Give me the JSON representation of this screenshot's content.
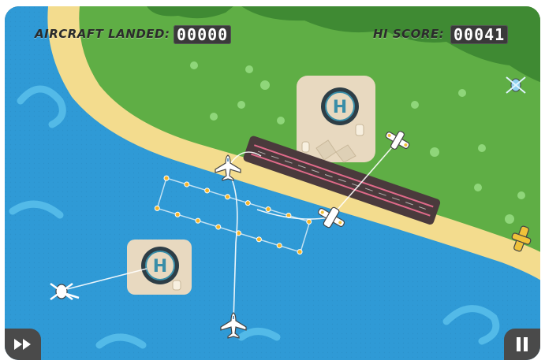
{
  "hud": {
    "aircraft_landed_label": "AIRCRAFT LANDED:",
    "aircraft_landed_value": "00000",
    "hi_score_label": "HI SCORE:",
    "hi_score_value": "00041"
  },
  "icons": {
    "fast_forward": "fast-forward-icon",
    "pause": "pause-icon",
    "helipad": "helipad-icon",
    "helicopter": "helicopter-icon",
    "airplane": "airplane-icon",
    "seaplane": "seaplane-icon"
  },
  "helipad_letter": "H",
  "colors": {
    "ocean": "#2f9ad6",
    "shallow_water": "#4cb6e6",
    "sand": "#f3dc8e",
    "grass": "#5fae45",
    "runway": "#4a3a3c",
    "runway_stripe": "#e06a8a",
    "helipad_pad": "#e8d9c0",
    "helipad_ring": "#2e3e46",
    "jet_white": "#ffffff",
    "seaplane_yellow": "#f0c23a"
  }
}
